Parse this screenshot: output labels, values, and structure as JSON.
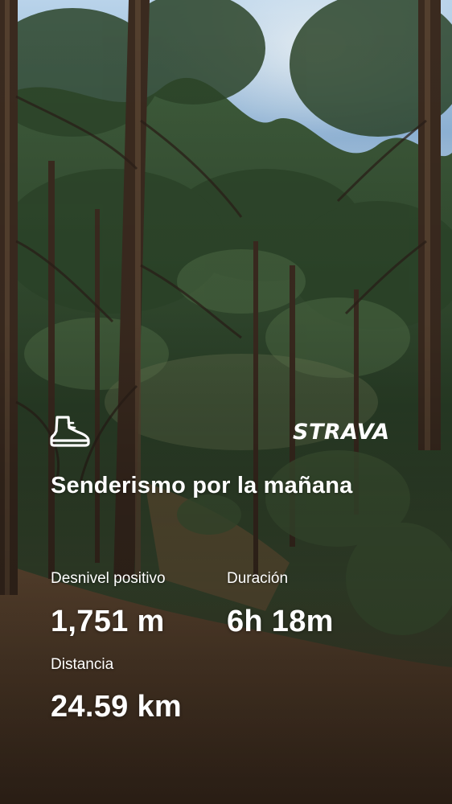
{
  "brand": {
    "logo_text": "STRAVA"
  },
  "activity": {
    "icon": "hiking-boot-icon",
    "title": "Senderismo por la mañana",
    "stats": [
      {
        "label": "Desnivel positivo",
        "value": "1,751 m"
      },
      {
        "label": "Duración",
        "value": "6h 18m"
      },
      {
        "label": "Distancia",
        "value": "24.59 km"
      }
    ]
  },
  "colors": {
    "text": "#ffffff",
    "sky": "#a9c6e0",
    "foliage": "#2f4a2a",
    "ground": "#6b4a33"
  }
}
